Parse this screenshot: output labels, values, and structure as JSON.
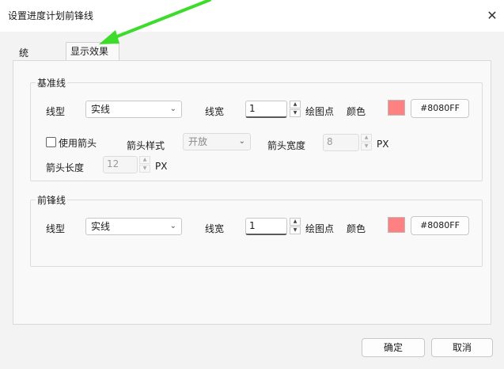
{
  "window": {
    "title": "设置进度计划前锋线"
  },
  "tabs": [
    {
      "label": "统计时间",
      "active": false
    },
    {
      "label": "显示效果",
      "active": true
    }
  ],
  "base_line": {
    "group_title": "基准线",
    "line_type_label": "线型",
    "line_type_value": "实线",
    "line_width_label": "线宽",
    "line_width_value": "1",
    "unit_label": "绘图点",
    "color_label": "颜色",
    "color_value": "#8080FF",
    "swatch_color": "#ff8080",
    "use_arrow_label": "使用箭头",
    "use_arrow_checked": false,
    "arrow_style_label": "箭头样式",
    "arrow_style_value": "开放",
    "arrow_width_label": "箭头宽度",
    "arrow_width_value": "8",
    "arrow_width_unit": "PX",
    "arrow_length_label": "箭头长度",
    "arrow_length_value": "12",
    "arrow_length_unit": "PX"
  },
  "front_line": {
    "group_title": "前锋线",
    "line_type_label": "线型",
    "line_type_value": "实线",
    "line_width_label": "线宽",
    "line_width_value": "1",
    "unit_label": "绘图点",
    "color_label": "颜色",
    "color_value": "#8080FF",
    "swatch_color": "#ff8080"
  },
  "footer": {
    "ok_label": "确定",
    "cancel_label": "取消"
  },
  "colors": {
    "annotation_arrow": "#3ddc2b"
  }
}
